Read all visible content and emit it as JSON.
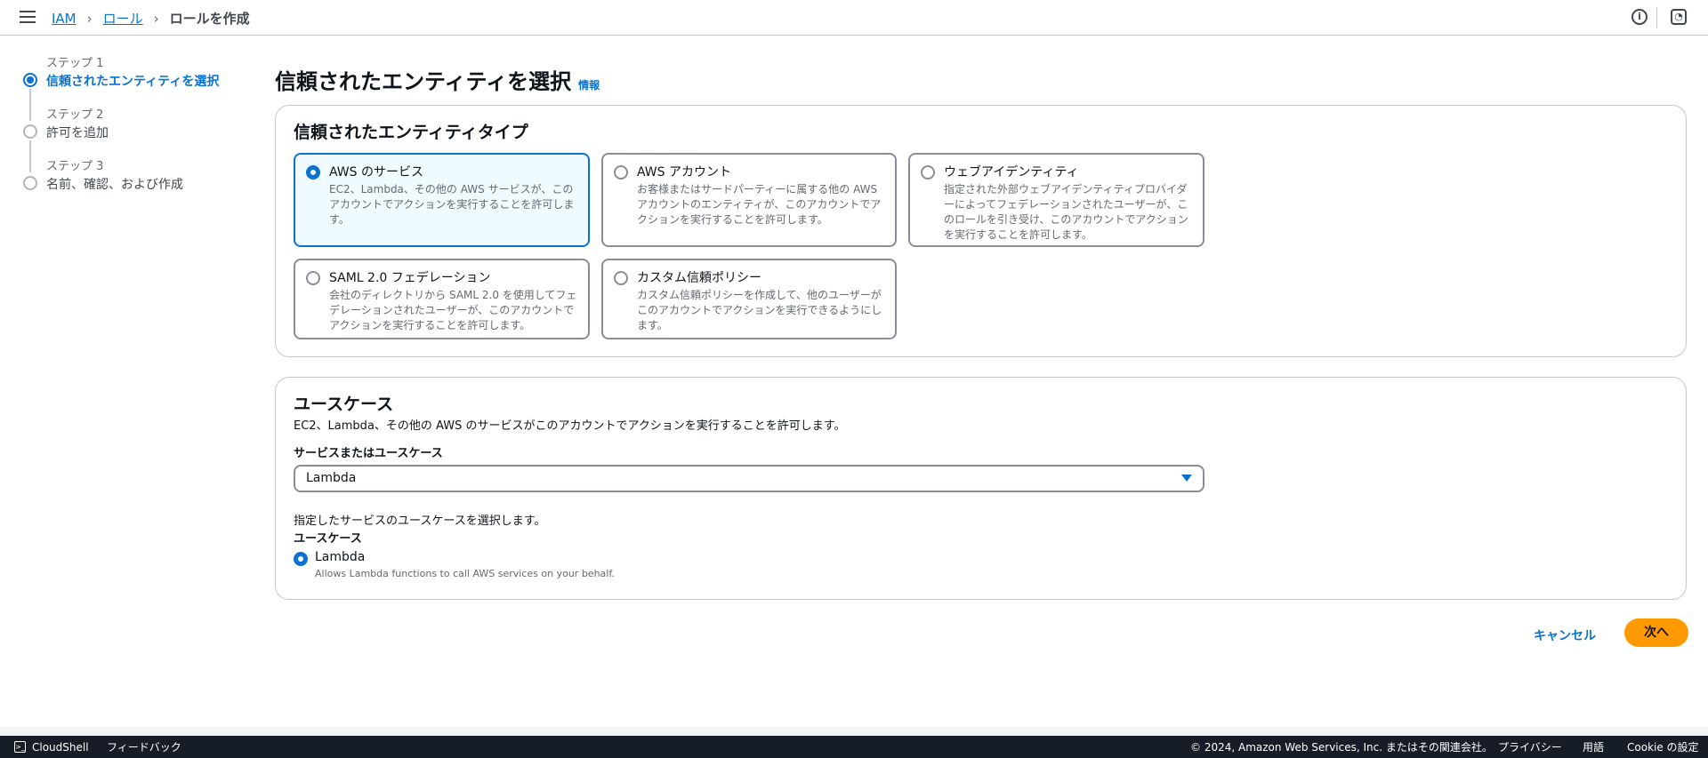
{
  "header": {
    "breadcrumb": [
      "IAM",
      "ロール",
      "ロールを作成"
    ],
    "info_icon": "info-icon",
    "notification_icon": "notification-icon"
  },
  "steps": [
    {
      "label": "ステップ 1",
      "name": "信頼されたエンティティを選択"
    },
    {
      "label": "ステップ 2",
      "name": "許可を追加"
    },
    {
      "label": "ステップ 3",
      "name": "名前、確認、および作成"
    }
  ],
  "page": {
    "title": "信頼されたエンティティを選択",
    "info": "情報"
  },
  "entity": {
    "heading": "信頼されたエンティティタイプ",
    "options": [
      {
        "title": "AWS のサービス",
        "desc": "EC2、Lambda、その他の AWS サービスが、このアカウントでアクションを実行することを許可します。",
        "selected": true
      },
      {
        "title": "AWS アカウント",
        "desc": "お客様またはサードパーティーに属する他の AWS アカウントのエンティティが、このアカウントでアクションを実行することを許可します。"
      },
      {
        "title": "ウェブアイデンティティ",
        "desc": "指定された外部ウェブアイデンティティプロバイダーによってフェデレーションされたユーザーが、このロールを引き受け、このアカウントでアクションを実行することを許可します。"
      },
      {
        "title": "SAML 2.0 フェデレーション",
        "desc": "会社のディレクトリから SAML 2.0 を使用してフェデレーションされたユーザーが、このアカウントでアクションを実行することを許可します。"
      },
      {
        "title": "カスタム信頼ポリシー",
        "desc": "カスタム信頼ポリシーを作成して、他のユーザーがこのアカウントでアクションを実行できるようにします。"
      }
    ]
  },
  "usecase": {
    "heading": "ユースケース",
    "desc": "EC2、Lambda、その他の AWS のサービスがこのアカウントでアクションを実行することを許可します。",
    "select_label": "サービスまたはユースケース",
    "select_value": "Lambda",
    "choose_desc": "指定したサービスのユースケースを選択します。",
    "choose_label": "ユースケース",
    "option_title": "Lambda",
    "option_desc": "Allows Lambda functions to call AWS services on your behalf."
  },
  "actions": {
    "cancel": "キャンセル",
    "next": "次へ"
  },
  "footer": {
    "cloudshell": "CloudShell",
    "feedback": "フィードバック",
    "copyright": "© 2024, Amazon Web Services, Inc. またはその関連会社。",
    "privacy": "プライバシー",
    "terms": "用語",
    "cookie": "Cookie の設定"
  },
  "colors": {
    "accent": "#0972d3",
    "primary_button": "#ff9900",
    "footer_bg": "#161d26"
  }
}
